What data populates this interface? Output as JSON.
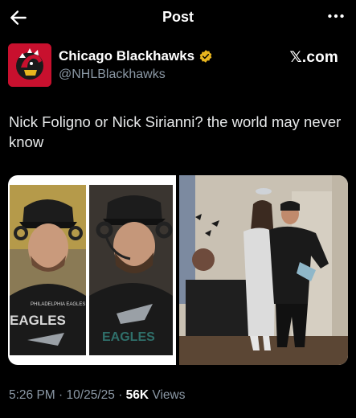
{
  "header": {
    "title": "Post",
    "back_icon": "arrow-left-icon",
    "more_icon": "more-horizontal-icon"
  },
  "author": {
    "name": "Chicago Blackhawks",
    "handle": "@NHLBlackhawks",
    "verified_icon": "gold-verified-badge-icon",
    "source_label": "𝕏.com",
    "avatar_icon": "blackhawks-logo-icon"
  },
  "post": {
    "text": "Nick Foligno or Nick Sirianni? the world may never know",
    "left_image_shirt_text": "PHILADELPHIA EAGLES",
    "left_image_shirt_text2": "EAGLES",
    "right_image": "halloween-costume-photo"
  },
  "meta": {
    "time": "5:26 PM",
    "sep1": "·",
    "date": "10/25/25",
    "sep2": "·",
    "views_count": "56K",
    "views_label": "Views"
  },
  "colors": {
    "background": "#000000",
    "text": "#e7e9ea",
    "secondary": "#8b98a5",
    "verified_gold": "#e8b51e",
    "blackhawks_red": "#c8102e"
  }
}
